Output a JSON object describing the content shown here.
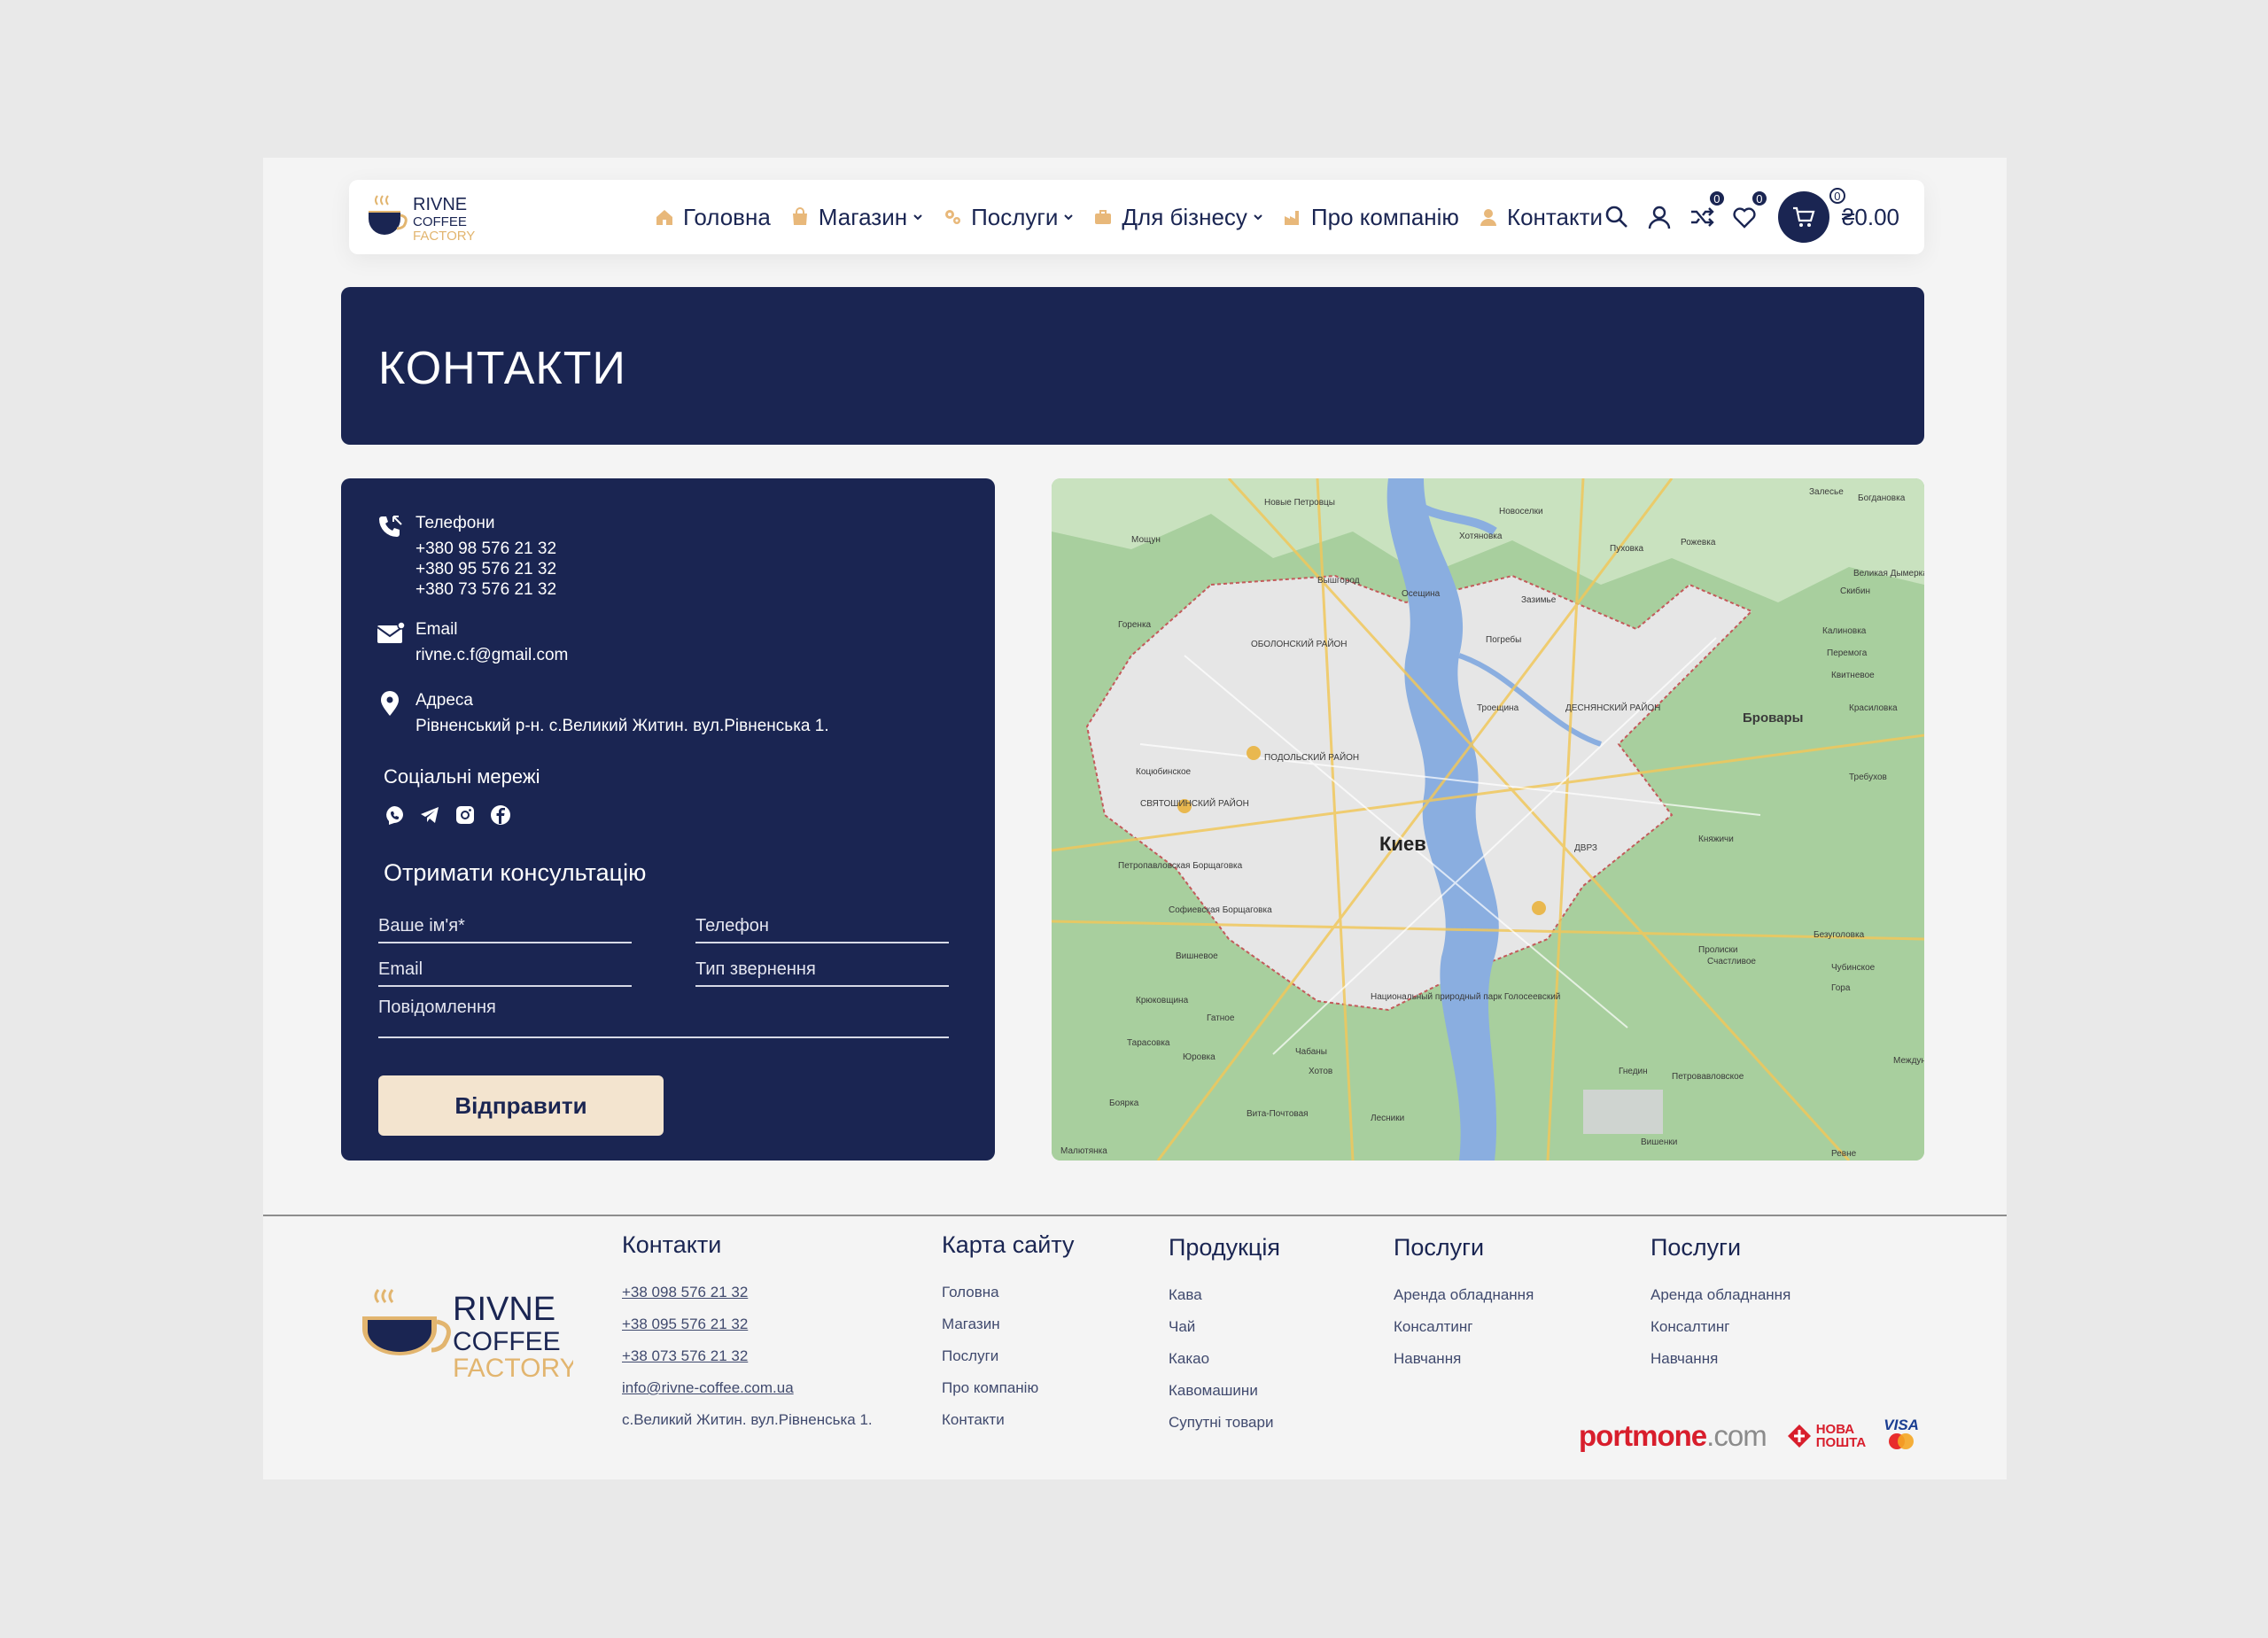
{
  "brand": {
    "line1": "RIVNE",
    "line2": "COFFEE",
    "line3": "FACTORY"
  },
  "nav": [
    {
      "label": "Головна",
      "icon": "home-icon",
      "dropdown": false
    },
    {
      "label": "Магазин",
      "icon": "bag-icon",
      "dropdown": true
    },
    {
      "label": "Послуги",
      "icon": "gears-icon",
      "dropdown": true
    },
    {
      "label": "Для бізнесу",
      "icon": "briefcase-icon",
      "dropdown": true
    },
    {
      "label": "Про компанію",
      "icon": "factory-icon",
      "dropdown": false
    },
    {
      "label": "Контакти",
      "icon": "person-icon",
      "dropdown": false
    }
  ],
  "header_icons": {
    "compare_count": "0",
    "wishlist_count": "0",
    "cart_count": "0",
    "cart_total": "₴0.00"
  },
  "banner": {
    "title": "КОНТАКТИ"
  },
  "contacts": {
    "phones_label": "Телефони",
    "phones": [
      "+380 98 576 21 32",
      "+380 95 576 21 32",
      "+380 73 576 21 32"
    ],
    "email_label": "Email",
    "email": "rivne.c.f@gmail.com",
    "address_label": "Адреса",
    "address": "Рівненський р-н. с.Великий Житин. вул.Рівненська 1.",
    "social_title": "Соціальні мережі",
    "social_icons": [
      "viber-icon",
      "telegram-icon",
      "instagram-icon",
      "facebook-icon"
    ]
  },
  "form": {
    "title": "Отримати консультацію",
    "name_placeholder": "Ваше ім'я*",
    "phone_placeholder": "Телефон",
    "email_placeholder": "Email",
    "type_placeholder": "Тип звернення",
    "message_placeholder": "Повідомлення",
    "submit_label": "Відправити"
  },
  "map": {
    "city": "Киев",
    "labels": [
      "Новые Петровцы",
      "Мощун",
      "Вышгород",
      "Осещина",
      "Новоселки",
      "Хотяновка",
      "Пуховка",
      "Рожевка",
      "Залесье",
      "Богдановка",
      "Скибин",
      "Великая Дымерка",
      "Горенка",
      "Зазимье",
      "Погребы",
      "Калиновка",
      "Перемога",
      "Квитневое",
      "ОБОЛОНСКИЙ РАЙОН",
      "Троещина",
      "ДЕСНЯНСКИЙ РАЙОН",
      "Бровары",
      "Красиловка",
      "ПОДОЛЬСКИЙ РАЙОН",
      "Коцюбинское",
      "Требухов",
      "СВЯТОШИНСКИЙ РАЙОН",
      "ДВРЗ",
      "Княжичи",
      "Петропавловская Борщаговка",
      "Софиевская Борщаговка",
      "Вишневое",
      "Безуголовка",
      "Пролиски",
      "Счастливое",
      "Чубинское",
      "Гора",
      "Крюковщина",
      "Гатное",
      "Национальный природный парк Голосеевский",
      "Тарасовка",
      "Юровка",
      "Чабаны",
      "Хотов",
      "Гнедин",
      "Петровавловское",
      "Международный аэропорт Борисполь",
      "Боярка",
      "Вита-Почтовая",
      "Лесники",
      "Вишенки",
      "Малютянка",
      "Ревне"
    ]
  },
  "footer": {
    "contacts": {
      "title": "Контакти",
      "items": [
        "+38 098 576 21 32",
        "+38 095 576 21 32",
        "+38 073 576 21 32",
        "info@rivne-coffee.com.ua",
        "с.Великий Житин. вул.Рівненська 1."
      ]
    },
    "sitemap": {
      "title": "Карта сайту",
      "items": [
        "Головна",
        "Магазин",
        "Послуги",
        "Про компанію",
        "Контакти"
      ]
    },
    "products": {
      "title": "Продукція",
      "items": [
        "Кава",
        "Чай",
        "Какао",
        "Кавомашини",
        "Супутні товари"
      ]
    },
    "services1": {
      "title": "Послуги",
      "items": [
        "Аренда обладнання",
        "Консалтинг",
        "Навчання"
      ]
    },
    "services2": {
      "title": "Послуги",
      "items": [
        "Аренда обладнання",
        "Консалтинг",
        "Навчання"
      ]
    },
    "payments": {
      "portmone_a": "portmone",
      "portmone_b": ".com",
      "novaposhta_a": "НОВА",
      "novaposhta_b": "ПОШТА",
      "visa": "VISA"
    }
  },
  "colors": {
    "navy": "#1a2552",
    "cream": "#f3e4cf",
    "gold": "#e2b56f",
    "page_bg": "#f4f4f4"
  }
}
